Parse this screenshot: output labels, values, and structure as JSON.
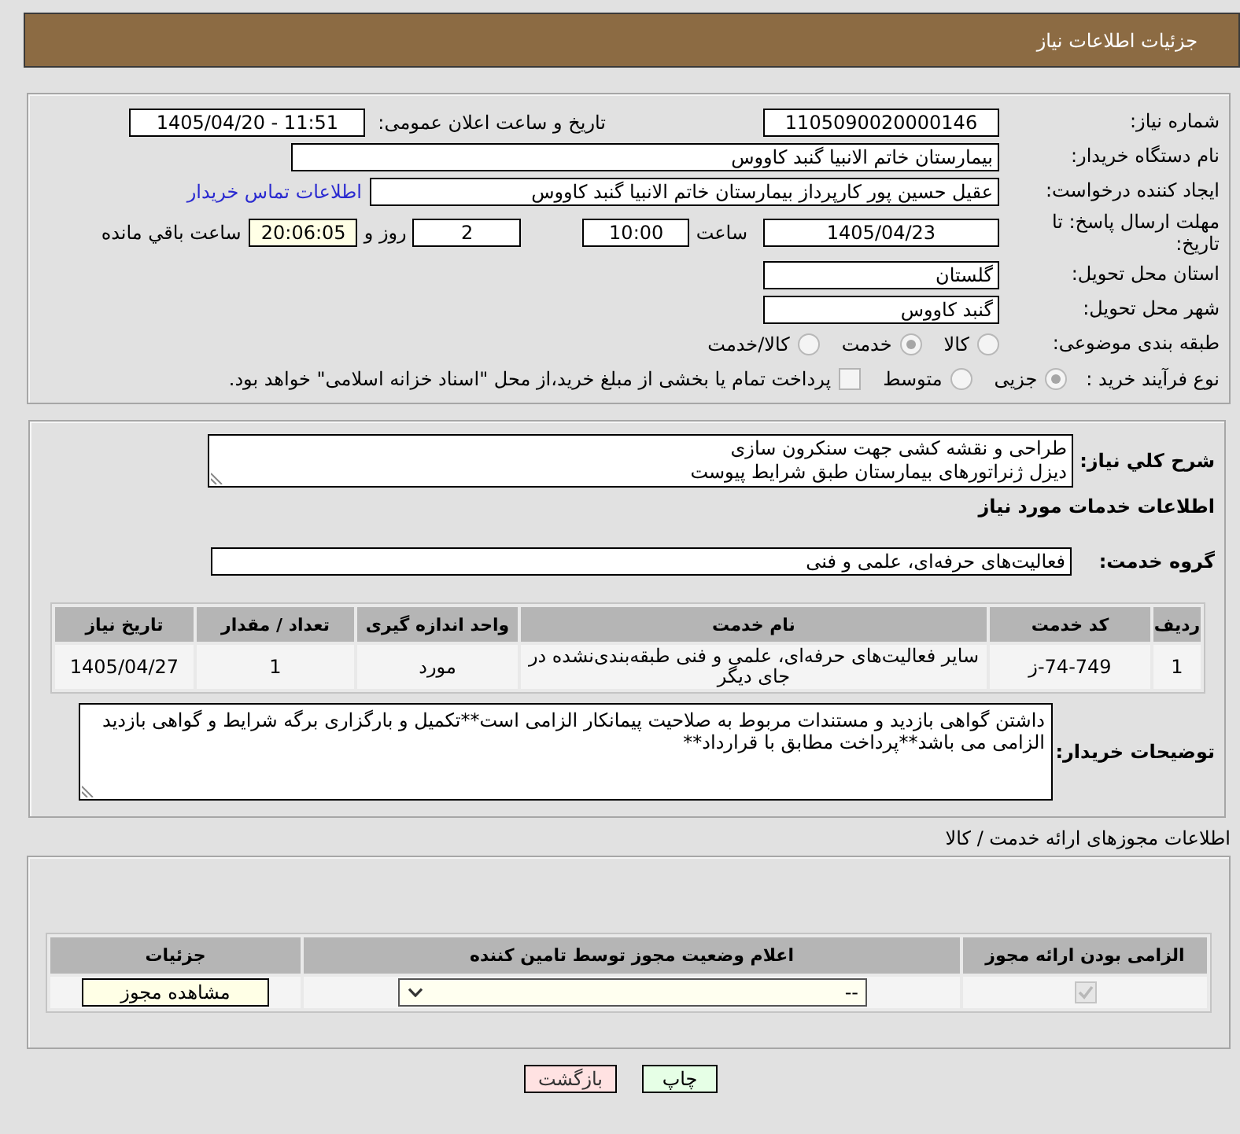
{
  "header": {
    "title": "جزئیات اطلاعات نیاز"
  },
  "details": {
    "need_number": {
      "label": "شماره نیاز:",
      "value": "1105090020000146"
    },
    "announce_date": {
      "label": "تاریخ و ساعت اعلان عمومی:",
      "value": "1405/04/20 - 11:51"
    },
    "buyer_org": {
      "label": "نام دستگاه خریدار:",
      "value": "بیمارستان خاتم الانبیا گنبد کاووس"
    },
    "requester": {
      "label": "ایجاد کننده درخواست:",
      "value": "عقیل حسین پور کارپرداز بیمارستان خاتم الانبیا گنبد کاووس",
      "link": "اطلاعات تماس خریدار"
    },
    "deadline": {
      "label": "مهلت ارسال پاسخ: تا تاریخ:",
      "date": "1405/04/23",
      "time_label": "ساعت",
      "time": "10:00",
      "days": "2",
      "days_label": "روز و",
      "remaining": "20:06:05",
      "remaining_label": "ساعت باقي مانده"
    },
    "province": {
      "label": "استان محل تحویل:",
      "value": "گلستان"
    },
    "city": {
      "label": "شهر محل تحویل:",
      "value": "گنبد کاووس"
    },
    "category": {
      "label": "طبقه بندی موضوعی:",
      "options": [
        {
          "label": "کالا",
          "selected": false
        },
        {
          "label": "خدمت",
          "selected": true
        },
        {
          "label": "کالا/خدمت",
          "selected": false
        }
      ]
    },
    "process": {
      "label": "نوع فرآیند خرید :",
      "options": [
        {
          "label": "جزیی",
          "selected": true
        },
        {
          "label": "متوسط",
          "selected": false
        }
      ],
      "treasury": {
        "label": "پرداخت تمام یا بخشی از مبلغ خرید،از محل \"اسناد خزانه اسلامی\" خواهد بود.",
        "checked": false
      }
    }
  },
  "need": {
    "summary": {
      "label": "شرح کلي نیاز:",
      "value": "طراحی و نقشه کشی جهت سنکرون سازی\nدیزل ژنراتورهای بیمارستان طبق شرایط پیوست"
    },
    "services_title": "اطلاعات خدمات مورد نیاز",
    "service_group": {
      "label": "گروه خدمت:",
      "value": "فعالیت‌های حرفه‌ای، علمی و فنی"
    },
    "table": {
      "columns": [
        "ردیف",
        "کد خدمت",
        "نام خدمت",
        "واحد اندازه گیری",
        "تعداد / مقدار",
        "تاریخ نیاز"
      ],
      "rows": [
        [
          "1",
          "ز-74-749",
          "سایر فعالیت‌های حرفه‌ای، علمی و فنی طبقه‌بندی‌نشده در جای دیگر",
          "مورد",
          "1",
          "1405/04/27"
        ]
      ]
    },
    "buyer_notes": {
      "label": "توضیحات خریدار:",
      "value": "داشتن گواهی بازدید و مستندات مربوط به صلاحیت پیمانکار الزامی است**تکمیل و بارگزاری برگه شرایط و گواهی بازدید الزامی می باشد**پرداخت مطابق با قرارداد**"
    }
  },
  "permits": {
    "title": "اطلاعات مجوزهای ارائه خدمت / کالا",
    "columns": [
      "الزامی بودن ارائه مجوز",
      "اعلام وضعیت مجوز توسط تامین کننده",
      "جزئیات"
    ],
    "rows": [
      {
        "required": true,
        "status": "--",
        "action": "مشاهده مجوز"
      }
    ]
  },
  "buttons": [
    {
      "label": "چاپ",
      "kind": "print"
    },
    {
      "label": "بازگشت",
      "kind": "back"
    }
  ]
}
